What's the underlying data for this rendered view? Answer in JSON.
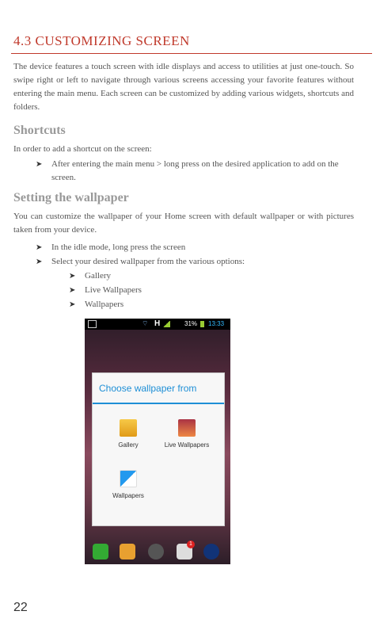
{
  "section_heading": "4.3 CUSTOMIZING SCREEN",
  "intro": "The device features a touch screen with idle displays and access to utilities at just one-touch. So swipe right or left to navigate through various screens accessing your favorite features without entering the main menu. Each screen can be customized by adding various widgets, shortcuts and folders.",
  "shortcuts": {
    "title": "Shortcuts",
    "text": "In order to add a shortcut on the screen:",
    "bullets": [
      "After entering the main menu > long press on the desired application to add on the screen."
    ]
  },
  "wallpaper": {
    "title": "Setting the wallpaper",
    "text": "You can customize the wallpaper of your Home screen with default wallpaper or with pictures taken from your device.",
    "bullets": [
      "In the idle mode, long press the screen",
      "Select your desired wallpaper from the various options:"
    ],
    "subbullets": [
      "Gallery",
      "Live Wallpapers",
      "Wallpapers"
    ]
  },
  "phone": {
    "status": {
      "network": "H",
      "battery": "31%",
      "time": "13:33"
    },
    "dialog_title": "Choose wallpaper from",
    "options": [
      "Gallery",
      "Live Wallpapers",
      "Wallpapers"
    ],
    "badge": "1"
  },
  "page_number": "22"
}
